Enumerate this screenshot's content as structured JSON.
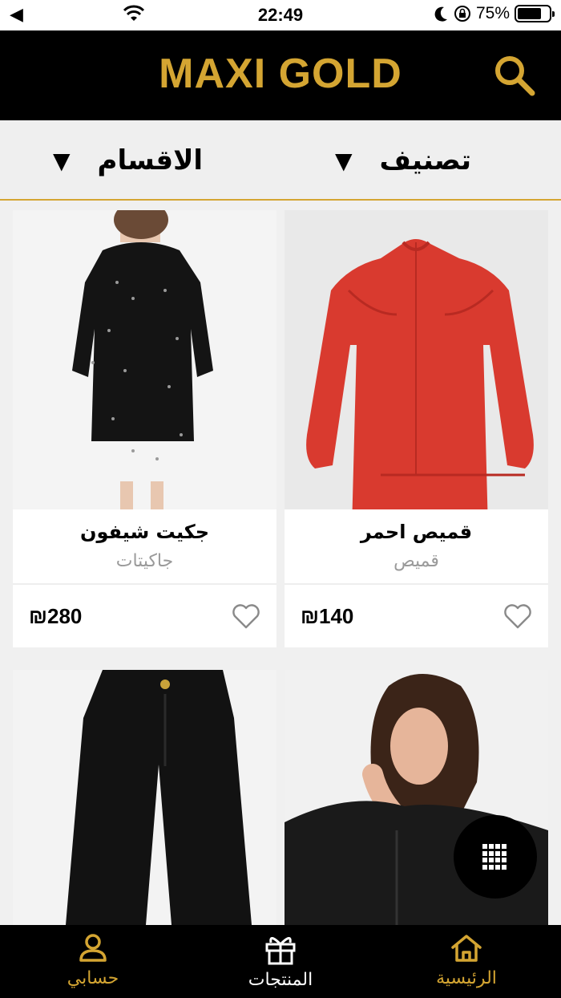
{
  "status_bar": {
    "back_glyph": "◀",
    "time": "22:49",
    "battery": "75%",
    "battery_level": 0.75,
    "icons": [
      "back-arrow-icon",
      "wifi-icon",
      "moon-icon",
      "orientation-lock-icon",
      "battery-icon"
    ]
  },
  "header": {
    "brand": "MAXI GOLD",
    "brand_color": "#d4a532",
    "search_icon": "search-icon"
  },
  "filters": {
    "classify": {
      "label": "تصنيف",
      "arrow": "▼"
    },
    "sections": {
      "label": "الاقسام",
      "arrow": "▼"
    }
  },
  "products": [
    {
      "name": "قميص احمر",
      "category": "قميص",
      "price": "₪140",
      "image": "red-blouse"
    },
    {
      "name": "جكيت شيفون",
      "category": "جاكيتات",
      "price": "₪280",
      "image": "black-chiffon-jacket"
    },
    {
      "name": "",
      "category": "",
      "price": "",
      "image": "black-jacket-model"
    },
    {
      "name": "",
      "category": "",
      "price": "",
      "image": "black-wide-pants"
    }
  ],
  "fab": {
    "icon": "grid-menu-icon"
  },
  "tabbar": {
    "home": {
      "label": "الرئيسية",
      "icon": "home-icon"
    },
    "products": {
      "label": "المنتجات",
      "icon": "gift-icon"
    },
    "account": {
      "label": "حسابي",
      "icon": "user-icon"
    }
  },
  "colors": {
    "accent": "#d4a532",
    "header_bg": "#000000",
    "tab_inactive": "#ffffff"
  }
}
